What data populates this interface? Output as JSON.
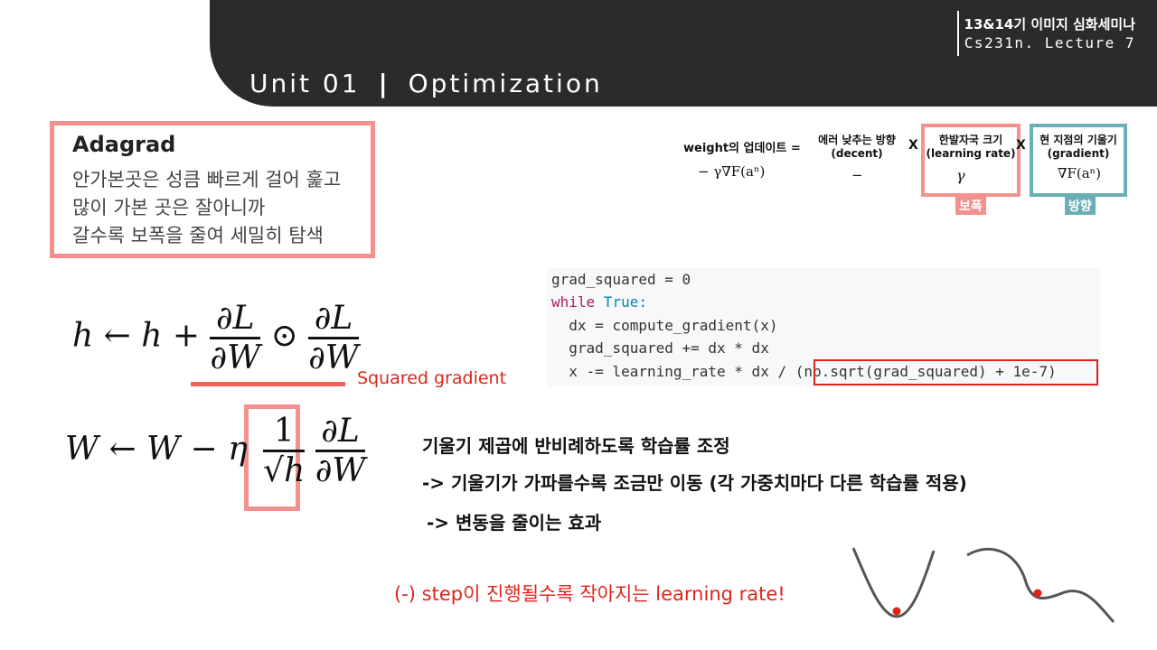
{
  "header": {
    "seminar": "13&14기 이미지 심화세미나",
    "lecture": "Cs231n. Lecture 7",
    "unit": "Unit  01",
    "divider": "|",
    "topic": "Optimization"
  },
  "adagrad": {
    "title": "Adagrad",
    "lines": [
      "안가본곳은 성큼 빠르게 걸어 훑고",
      "많이 가본 곳은 잘아니까",
      "갈수록 보폭을 줄여 세밀히 탐색"
    ]
  },
  "update_rule": {
    "weight_label": "weight의 업데이트 =",
    "weight_math": "− γ∇F(aⁿ)",
    "decent_label_1": "에러 낮추는 방향",
    "decent_label_2": "(decent)",
    "decent_math": "−",
    "times_1": "X",
    "lr_label_1": "한발자국 크기",
    "lr_label_2": "(learning rate)",
    "lr_math": "γ",
    "times_2": "X",
    "grad_label_1": "현 지점의 기울기",
    "grad_label_2": "(gradient)",
    "grad_math": "∇F(aⁿ)",
    "stride_tag": "보폭",
    "direction_tag": "방향",
    "colors": {
      "pink": "#f4918f",
      "teal": "#6aaeb8"
    }
  },
  "code": {
    "line1": "grad_squared = 0",
    "line2_kw": "while",
    "line2_rest": " True:",
    "line3": "  dx = compute_gradient(x)",
    "line4": "  grad_squared += dx * dx",
    "line5a": "  x -= learning_rate * dx / ",
    "line5b": "(np.sqrt(grad_squared) + 1e-7)"
  },
  "formula1": {
    "lhs": "h ← h +",
    "numer": "∂L",
    "denom": "∂W",
    "op": "⊙",
    "caption": "Squared gradient"
  },
  "formula2": {
    "lhs": "W ← W − η",
    "one": "1",
    "sqrt": "√h",
    "numer": "∂L",
    "denom": "∂W"
  },
  "notes": {
    "line1": "기울기 제곱에 반비례하도록 학습률 조정",
    "line2": "-> 기울기가 가파를수록 조금만 이동 (각 가중치마다 다른 학습률 적용)",
    "line3": "-> 변동을 줄이는 효과",
    "conclusion": "(-) step이 진행될수록 작아지는 learning rate!"
  },
  "accent_red": "#e0241c"
}
